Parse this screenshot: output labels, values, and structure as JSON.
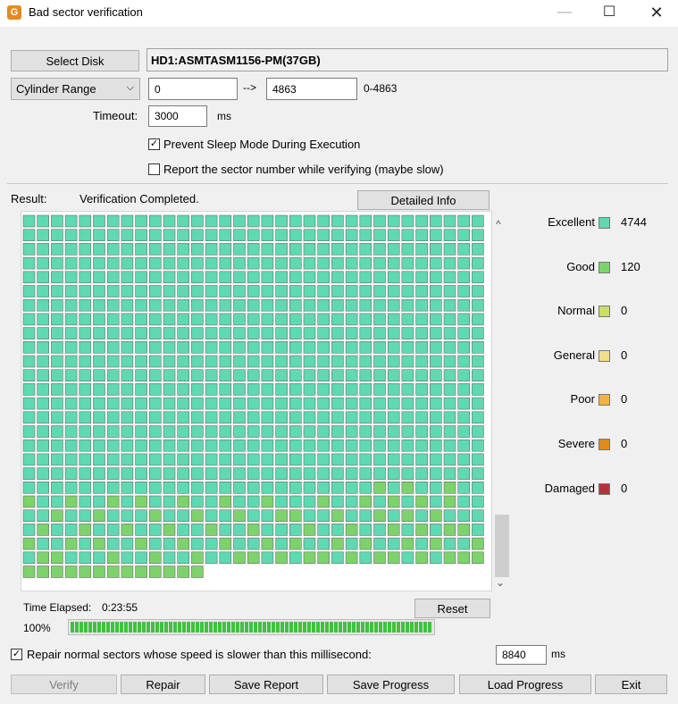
{
  "window": {
    "title": "Bad sector verification",
    "icon": "app-logo-icon"
  },
  "disk": {
    "select_label": "Select Disk",
    "name": "HD1:ASMTASM1156-PM(37GB)"
  },
  "range": {
    "mode": "Cylinder Range",
    "from": "0",
    "arrow": "-->",
    "to": "4863",
    "limits": "0-4863"
  },
  "timeout": {
    "label": "Timeout:",
    "value": "3000",
    "unit": "ms"
  },
  "options": {
    "prevent_sleep": {
      "label": "Prevent Sleep Mode During Execution",
      "checked": true
    },
    "report_sector": {
      "label": "Report the sector number while verifying (maybe slow)",
      "checked": false
    }
  },
  "result": {
    "label": "Result:",
    "status": "Verification Completed.",
    "detailed_label": "Detailed Info"
  },
  "legend": [
    {
      "name": "Excellent",
      "count": "4744",
      "color": "#5fd9b2"
    },
    {
      "name": "Good",
      "count": "120",
      "color": "#7dd36b"
    },
    {
      "name": "Normal",
      "count": "0",
      "color": "#c8dd6a"
    },
    {
      "name": "General",
      "count": "0",
      "color": "#f2dd8a"
    },
    {
      "name": "Poor",
      "count": "0",
      "color": "#f0b43a"
    },
    {
      "name": "Severe",
      "count": "0",
      "color": "#dd8a1f"
    },
    {
      "name": "Damaged",
      "count": "0",
      "color": "#b5313c"
    }
  ],
  "grid": {
    "columns": 33,
    "visible_rows": 26,
    "last_row_blocks": 13,
    "good_rows": [
      20,
      21,
      22,
      23,
      24,
      25
    ],
    "good_cells": {
      "19": [
        25,
        27,
        30
      ],
      "20": [
        0,
        3,
        6,
        8,
        11,
        14,
        17,
        21,
        24,
        26,
        28,
        30
      ],
      "21": [
        2,
        5,
        9,
        12,
        15,
        18,
        19,
        22,
        25,
        27,
        29
      ],
      "22": [
        1,
        4,
        7,
        10,
        13,
        16,
        20,
        23,
        26,
        28,
        30,
        31
      ],
      "23": [
        0,
        3,
        5,
        8,
        11,
        14,
        17,
        19,
        22,
        24,
        27,
        29,
        32
      ],
      "24": [
        1,
        2,
        6,
        9,
        12,
        15,
        16,
        18,
        20,
        21,
        23,
        25,
        26,
        28,
        30,
        31,
        32
      ],
      "25": [
        0,
        4,
        7,
        10,
        11,
        13,
        14,
        17,
        19,
        22,
        24,
        27,
        29,
        31
      ]
    }
  },
  "timing": {
    "elapsed_label": "Time Elapsed:",
    "elapsed_value": "0:23:55",
    "reset_label": "Reset",
    "percent": "100%",
    "progress_fraction": 1.0,
    "progress_color": "#3fc23f"
  },
  "repair_option": {
    "label": "Repair normal sectors whose speed is slower than this millisecond:",
    "checked": true,
    "value": "8840",
    "unit": "ms"
  },
  "buttons": {
    "verify": "Verify",
    "repair": "Repair",
    "save_report": "Save Report",
    "save_progress": "Save Progress",
    "load_progress": "Load Progress",
    "exit": "Exit"
  }
}
